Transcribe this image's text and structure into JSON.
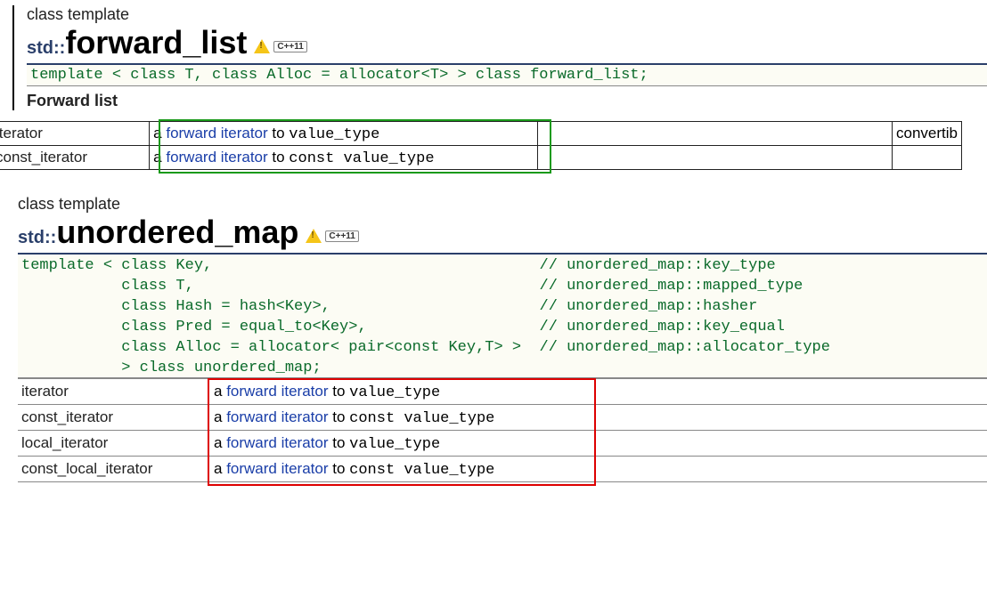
{
  "section1": {
    "label": "class template",
    "ns": "std::",
    "title": "forward_list",
    "tag": "C++11",
    "proto": "template < class T, class Alloc = allocator<T> > class forward_list;",
    "subhead": "Forward list",
    "rows": [
      {
        "name": "iterator",
        "desc_pre": "a ",
        "desc_link": "forward iterator",
        "desc_mid": " to ",
        "desc_code": "value_type"
      },
      {
        "name": "const_iterator",
        "desc_pre": "a ",
        "desc_link": "forward iterator",
        "desc_mid": " to ",
        "desc_code": "const value_type"
      }
    ],
    "convertible_label": "convertib"
  },
  "section2": {
    "label": "class template",
    "ns": "std::",
    "title": "unordered_map",
    "tag": "C++11",
    "proto": "template < class Key,                                    // unordered_map::key_type\n           class T,                                      // unordered_map::mapped_type\n           class Hash = hash<Key>,                       // unordered_map::hasher\n           class Pred = equal_to<Key>,                   // unordered_map::key_equal\n           class Alloc = allocator< pair<const Key,T> >  // unordered_map::allocator_type\n           > class unordered_map;",
    "rows": [
      {
        "name": "iterator",
        "desc_pre": "a ",
        "desc_link": "forward iterator",
        "desc_mid": " to ",
        "desc_code": "value_type"
      },
      {
        "name": "const_iterator",
        "desc_pre": "a ",
        "desc_link": "forward iterator",
        "desc_mid": " to ",
        "desc_code": "const value_type"
      },
      {
        "name": "local_iterator",
        "desc_pre": "a ",
        "desc_link": "forward iterator",
        "desc_mid": " to ",
        "desc_code": "value_type"
      },
      {
        "name": "const_local_iterator",
        "desc_pre": "a ",
        "desc_link": "forward iterator",
        "desc_mid": " to ",
        "desc_code": "const value_type"
      }
    ]
  }
}
